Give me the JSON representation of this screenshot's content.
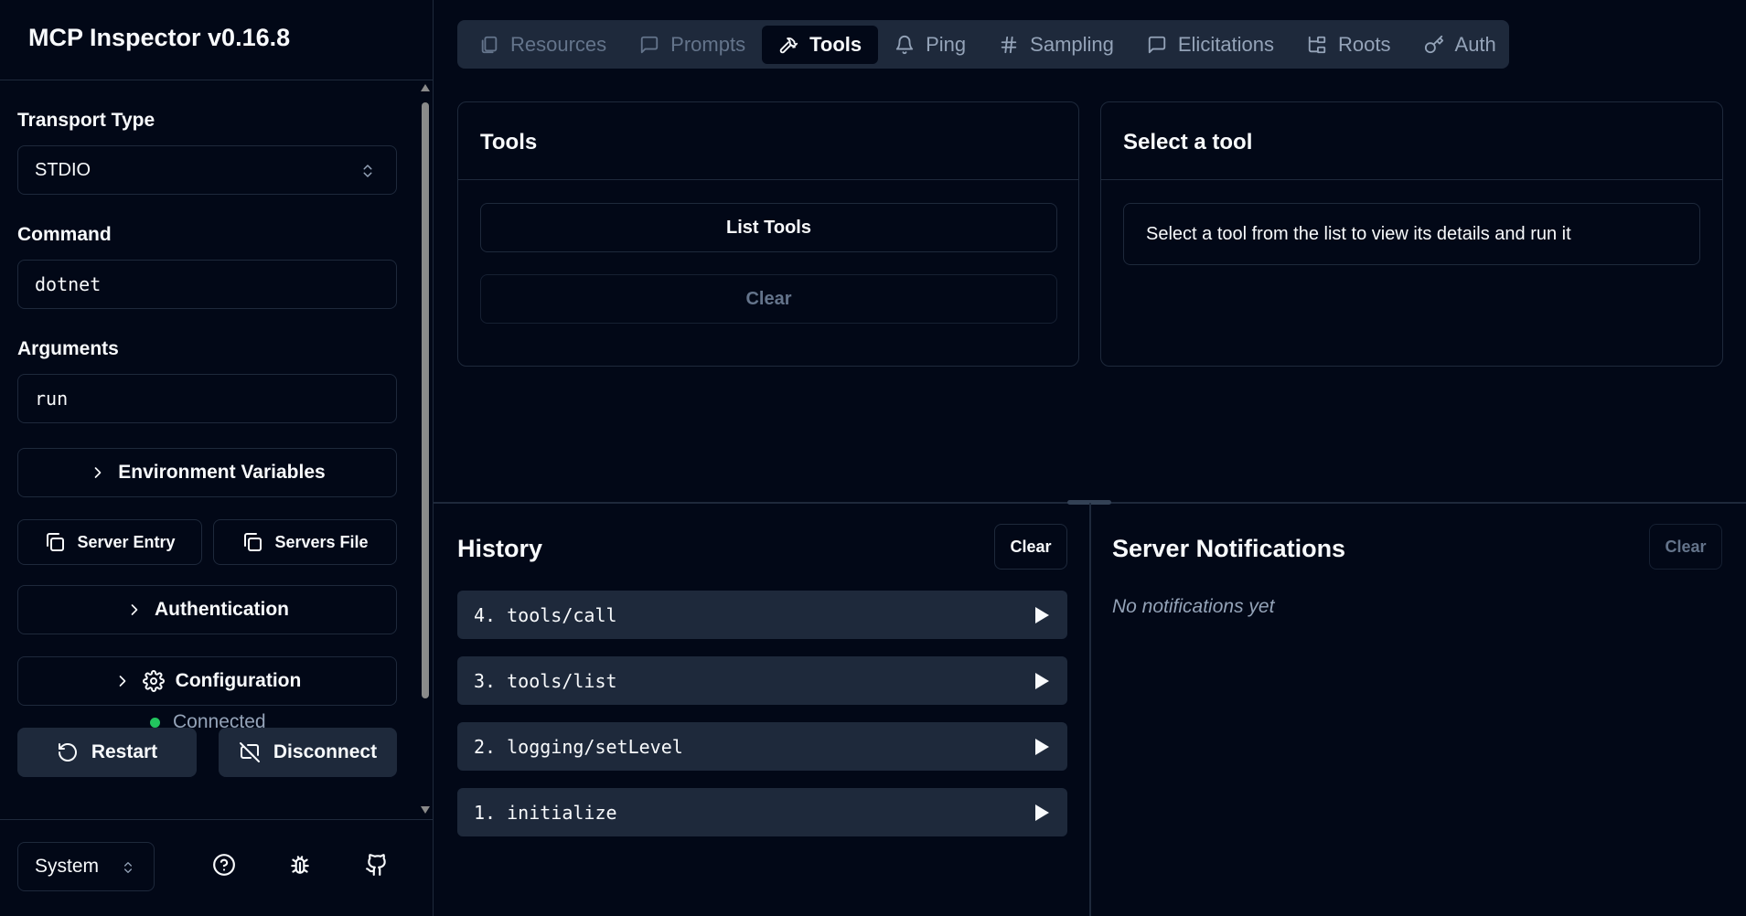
{
  "app": {
    "title": "MCP Inspector v0.16.8"
  },
  "sidebar": {
    "transport": {
      "label": "Transport Type",
      "value": "STDIO"
    },
    "command": {
      "label": "Command",
      "value": "dotnet"
    },
    "arguments": {
      "label": "Arguments",
      "value": "run"
    },
    "env_button": "Environment Variables",
    "server_entry_button": "Server Entry",
    "servers_file_button": "Servers File",
    "auth_button": "Authentication",
    "config_button": "Configuration",
    "restart_button": "Restart",
    "disconnect_button": "Disconnect",
    "status": {
      "text": "Connected",
      "color": "#22c55e"
    },
    "theme": {
      "value": "System"
    },
    "footer_icons": [
      "help-circle-icon",
      "bug-icon",
      "github-icon"
    ]
  },
  "tabs": [
    {
      "label": "Resources",
      "icon": "files-icon",
      "state": "disabled"
    },
    {
      "label": "Prompts",
      "icon": "message-square-icon",
      "state": "disabled"
    },
    {
      "label": "Tools",
      "icon": "hammer-icon",
      "state": "active"
    },
    {
      "label": "Ping",
      "icon": "bell-icon",
      "state": "normal"
    },
    {
      "label": "Sampling",
      "icon": "hash-icon",
      "state": "normal"
    },
    {
      "label": "Elicitations",
      "icon": "message-square-icon",
      "state": "normal"
    },
    {
      "label": "Roots",
      "icon": "folder-tree-icon",
      "state": "normal"
    },
    {
      "label": "Auth",
      "icon": "key-icon",
      "state": "normal"
    }
  ],
  "tools_panel": {
    "title": "Tools",
    "list_button": "List Tools",
    "clear_button": "Clear"
  },
  "select_panel": {
    "title": "Select a tool",
    "message": "Select a tool from the list to view its details and run it"
  },
  "history": {
    "title": "History",
    "clear_button": "Clear",
    "items": [
      "4. tools/call",
      "3. tools/list",
      "2. logging/setLevel",
      "1. initialize"
    ]
  },
  "notifications": {
    "title": "Server Notifications",
    "clear_button": "Clear",
    "empty_text": "No notifications yet"
  },
  "colors": {
    "background": "#020817",
    "border": "#1e293b",
    "muted": "#94a3b8",
    "accent_green": "#22c55e"
  }
}
